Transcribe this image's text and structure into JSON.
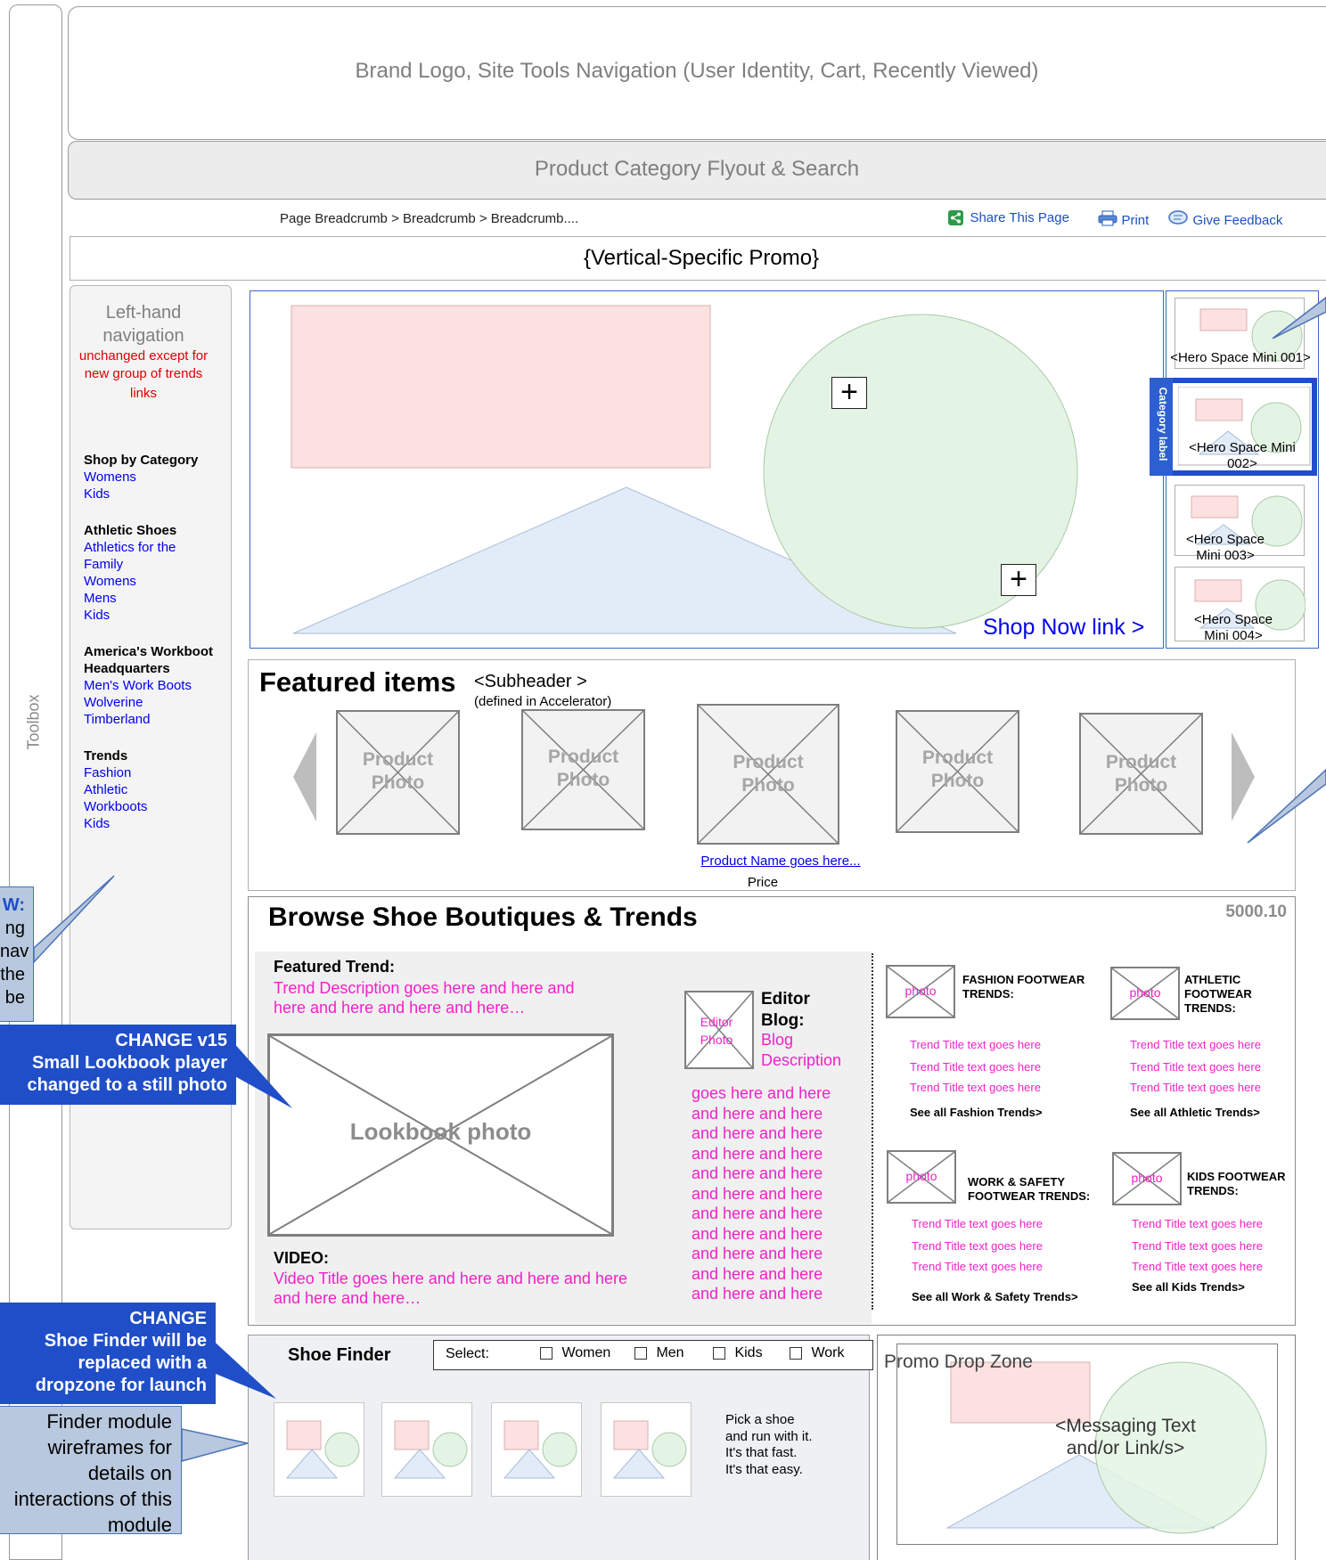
{
  "toolbox": {
    "label": "Toolbox"
  },
  "header": {
    "title": "Brand Logo, Site Tools Navigation (User Identity, Cart, Recently Viewed)"
  },
  "flyout": {
    "title": "Product Category Flyout & Search"
  },
  "breadcrumb": {
    "text": "Page Breadcrumb > Breadcrumb > Breadcrumb...."
  },
  "tools": {
    "share": "Share This Page",
    "print": "Print",
    "feedback": "Give Feedback"
  },
  "promo": {
    "title": "{Vertical-Specific Promo}"
  },
  "leftnav": {
    "title_line1": "Left-hand",
    "title_line2": "navigation",
    "note": "unchanged except for new group of trends",
    "note_links": "links",
    "groups": [
      {
        "heading": "Shop by Category",
        "items": [
          "Womens",
          "Kids"
        ]
      },
      {
        "heading": "Athletic Shoes",
        "items": [
          "Athletics for the Family",
          "Womens",
          "Mens",
          "Kids"
        ]
      },
      {
        "heading": "America's Workboot Headquarters",
        "items": [
          "Men's Work Boots",
          "Wolverine",
          "Timberland"
        ]
      },
      {
        "heading": "Trends",
        "items": [
          "Fashion",
          "Athletic",
          "Workboots",
          "Kids"
        ]
      }
    ]
  },
  "hero": {
    "shop_now": "Shop Now link >",
    "plus": "+",
    "category_label": "Category label",
    "minis": [
      "<Hero Space Mini 001>",
      "<Hero Space Mini 002>",
      "<Hero Space Mini 003>",
      "<Hero Space Mini 004>"
    ]
  },
  "featured": {
    "title": "Featured items",
    "subheader": "<Subheader >",
    "subheader_note": "(defined in Accelerator)",
    "product_label_1": "Product",
    "product_label_2": "Photo",
    "product_name": "Product Name goes here...",
    "price": "Price"
  },
  "browse": {
    "title": "Browse Shoe Boutiques & Trends",
    "code": "5000.10",
    "featured_trend_label": "Featured Trend:",
    "featured_trend_desc": "Trend Description goes here and here and here and here and here and here…",
    "lookbook": "Lookbook photo",
    "video_label": "VIDEO:",
    "video_title": "Video Title goes here and here and here and here and here and here…",
    "editor_photo": "Editor Photo",
    "editor_blog": "Editor Blog:",
    "blog_desc": "Blog Description",
    "blog_more": [
      "goes here and here",
      "and here and here",
      "and here and here",
      "and here and here",
      "and here and here",
      "and here and here",
      "and here and here",
      "and here and here",
      "and here and here",
      "and here and here",
      "and here and here"
    ],
    "photo": "photo",
    "trend_item": "Trend Title text goes here",
    "trends": [
      {
        "heading": "FASHION FOOTWEAR TRENDS:",
        "see_all": "See all Fashion Trends>"
      },
      {
        "heading": "ATHLETIC FOOTWEAR TRENDS:",
        "see_all": "See all Athletic Trends>"
      },
      {
        "heading": "WORK & SAFETY FOOTWEAR TRENDS:",
        "see_all": "See all Work & Safety Trends>"
      },
      {
        "heading": "KIDS FOOTWEAR TRENDS:",
        "see_all": "See all Kids Trends>"
      }
    ]
  },
  "shoefinder": {
    "title": "Shoe Finder",
    "select": "Select:",
    "options": [
      "Women",
      "Men",
      "Kids",
      "Work"
    ],
    "tagline": [
      "Pick a shoe",
      "and run with it.",
      "It's that fast.",
      "It's that easy."
    ]
  },
  "dropzone": {
    "title": "Promo Drop Zone",
    "messaging": "<Messaging Text and/or Link/s>"
  },
  "callouts": {
    "left_w_head": "W:",
    "left_w_lines": [
      "ng",
      "nav",
      "the",
      "be"
    ],
    "v15_title": "CHANGE v15",
    "v15_body": "Small Lookbook player changed to a still photo",
    "change_title": "CHANGE",
    "change_body": "Shoe Finder will be replaced with a dropzone for launch",
    "finder_note": "Finder module wireframes for details on interactions of this module"
  },
  "colors": {
    "accent_blue": "#1f4ec8",
    "pink": "#f021c8",
    "link_blue": "#0000ee"
  }
}
